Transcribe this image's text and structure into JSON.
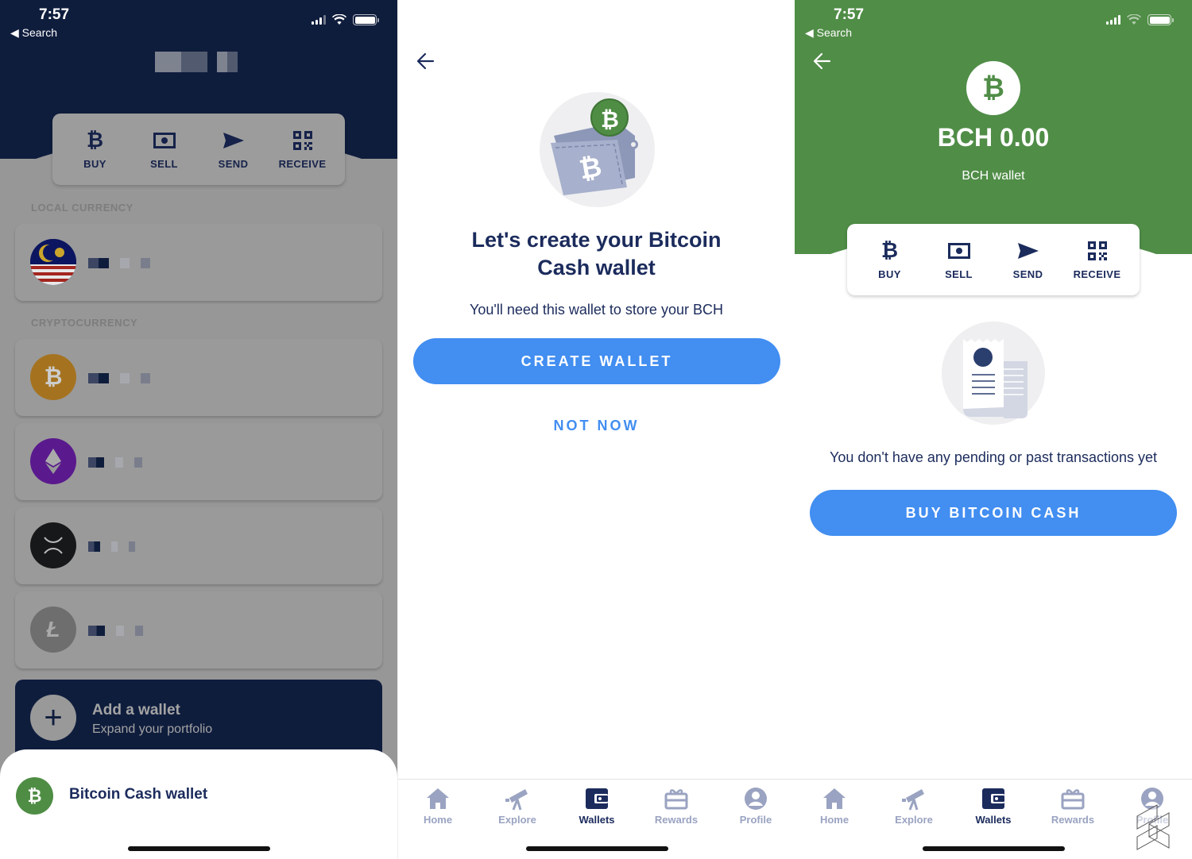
{
  "status_bar": {
    "time": "7:57",
    "back_app": "◀ Search"
  },
  "actions": [
    {
      "label": "BUY",
      "icon": "bitcoin-icon"
    },
    {
      "label": "SELL",
      "icon": "banknote-icon"
    },
    {
      "label": "SEND",
      "icon": "send-icon"
    },
    {
      "label": "RECEIVE",
      "icon": "qr-code-icon"
    }
  ],
  "screen1": {
    "balance_masked": true,
    "sections": {
      "local": "LOCAL CURRENCY",
      "crypto": "CRYPTOCURRENCY"
    },
    "wallets": [
      {
        "icon": "malaysia-flag-icon",
        "section": "local"
      },
      {
        "icon": "bitcoin-coin-icon",
        "section": "crypto",
        "color": "#d28b1e"
      },
      {
        "icon": "ethereum-coin-icon",
        "section": "crypto",
        "color": "#6a1fb0"
      },
      {
        "icon": "xrp-coin-icon",
        "section": "crypto",
        "color": "#17181a"
      },
      {
        "icon": "litecoin-coin-icon",
        "section": "crypto",
        "color": "#6e6e6e"
      }
    ],
    "add_wallet": {
      "title": "Add a wallet",
      "subtitle": "Expand your portfolio"
    },
    "sheet": {
      "item": "Bitcoin Cash wallet",
      "icon": "bitcoin-cash-icon"
    }
  },
  "screen2": {
    "title": "Let's create your Bitcoin Cash wallet",
    "subtitle": "You'll need this wallet to store your BCH",
    "primary": "CREATE WALLET",
    "secondary": "NOT NOW"
  },
  "screen3": {
    "balance": "BCH 0.00",
    "wallet_name": "BCH wallet",
    "empty_state": "You don't have any pending or past transactions yet",
    "primary": "BUY BITCOIN CASH"
  },
  "tabbar": {
    "active": "Wallets",
    "items": [
      {
        "label": "Home",
        "icon": "home-icon"
      },
      {
        "label": "Explore",
        "icon": "telescope-icon"
      },
      {
        "label": "Wallets",
        "icon": "wallet-icon"
      },
      {
        "label": "Rewards",
        "icon": "gift-card-icon"
      },
      {
        "label": "Profile",
        "icon": "profile-icon"
      }
    ]
  },
  "colors": {
    "navy": "#0f1d3d",
    "text_navy": "#1b2b5c",
    "bch_green": "#508d47",
    "primary_blue": "#428ef1",
    "tab_inactive": "#9aa3c1"
  }
}
